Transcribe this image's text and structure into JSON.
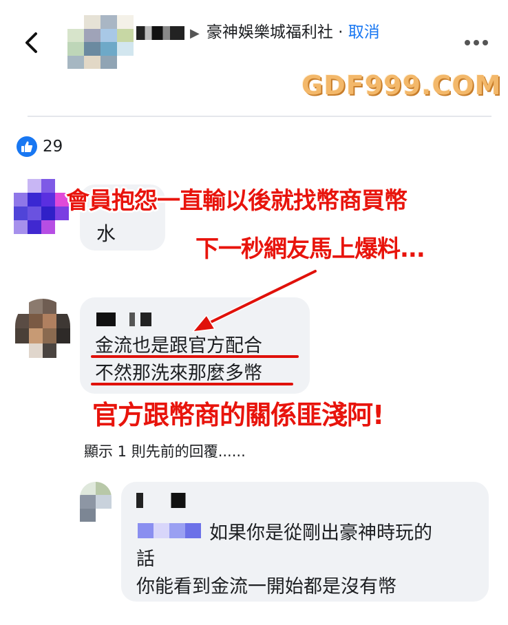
{
  "header": {
    "group_name": "豪神娛樂城福利社",
    "separator": "·",
    "cancel_label": "取消"
  },
  "watermark": "GDF999.COM",
  "reactions": {
    "count": "29"
  },
  "comments": [
    {
      "text": "水"
    },
    {
      "lines": [
        "金流也是跟官方配合",
        "不然那洗來那麼多幣"
      ]
    }
  ],
  "view_previous": "顯示 1 則先前的回覆......",
  "reply": {
    "line1": "如果你是從剛出豪神時玩的",
    "line2": "話",
    "line3": "你能看到金流一開始都是沒有幣"
  },
  "annotations": {
    "a1": "會員抱怨一直輸以後就找幣商買幣",
    "a2": "下一秒網友馬上爆料...",
    "a3": "官方跟幣商的關係匪淺阿!"
  },
  "colors": {
    "facebook_blue": "#1877f2",
    "bubble_bg": "#f0f2f5",
    "annotation_red": "#e8140c",
    "watermark_orange": "#f3b86a"
  },
  "icons": [
    "back-arrow-icon",
    "more-dots-icon",
    "like-thumb-icon"
  ]
}
